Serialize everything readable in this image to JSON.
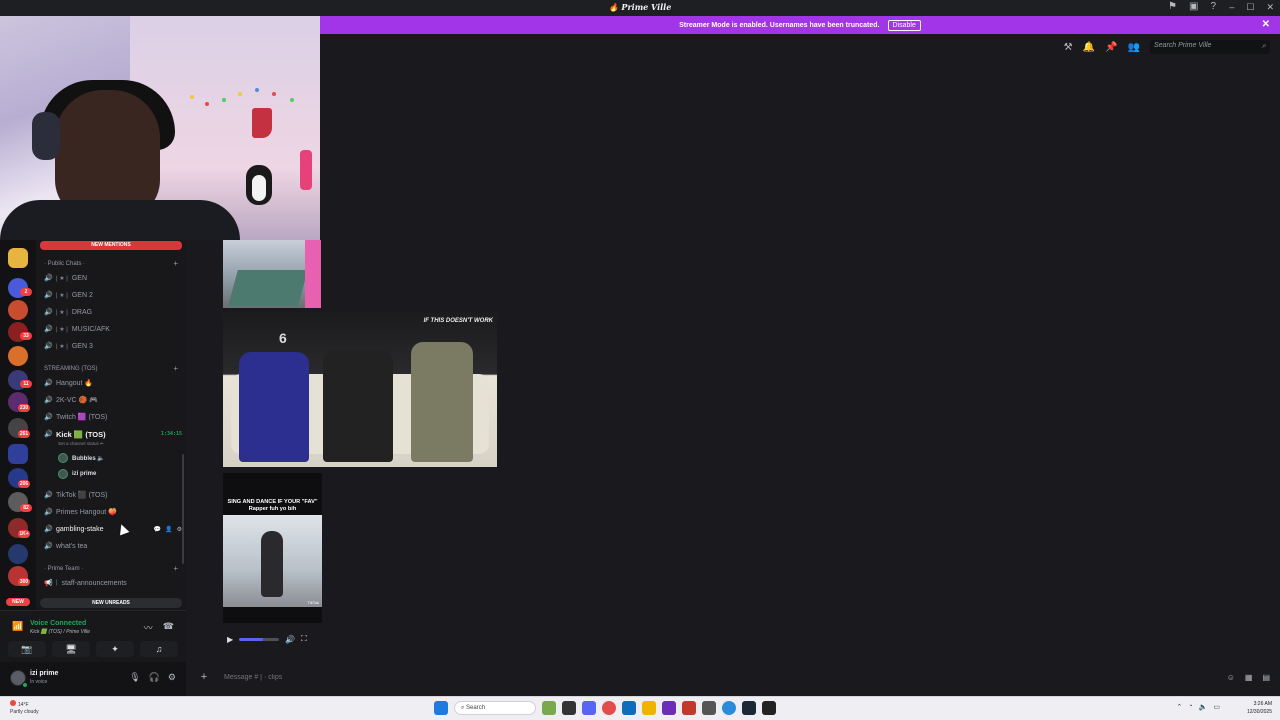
{
  "app": {
    "title": "Prime Ville",
    "title_icon": "discord-logo-icon",
    "window_controls": [
      "–",
      "☐",
      "✕"
    ]
  },
  "banner": {
    "text": "Streamer Mode is enabled. Usernames have been truncated.",
    "button": "Disable",
    "color": "#a335e8"
  },
  "header": {
    "search_placeholder": "Search Prime Ville"
  },
  "server_rail": {
    "badges": [
      "2",
      "33",
      "11",
      "230",
      "261",
      "206",
      "82",
      "1K+",
      "300"
    ],
    "new_label": "NEW"
  },
  "channels": {
    "new_mentions": "NEW MENTIONS",
    "new_unreads": "NEW UNREADS",
    "categories": [
      {
        "label": "· Public Chats ·"
      },
      {
        "label": "STREAMING (TOS)"
      },
      {
        "label": "· Prime Team ·"
      }
    ],
    "public": [
      {
        "label": "GEN"
      },
      {
        "label": "GEN 2"
      },
      {
        "label": "DRAG"
      },
      {
        "label": "MUSIC/AFK"
      },
      {
        "label": "GEN 3"
      }
    ],
    "streaming": [
      {
        "label": "Hangout 🔥"
      },
      {
        "label": "2K-VC 🏀 🎮"
      },
      {
        "label": "Twitch 🟪 (TOS)"
      }
    ],
    "active": {
      "label": "Kick 🟩 (TOS)",
      "timer": "1:34:15",
      "status": "Set a channel status ✏"
    },
    "voice_users": [
      {
        "name": "Bubbles 🔈"
      },
      {
        "name": "izi prime"
      }
    ],
    "more": [
      {
        "label": "TikTok ⬛ (TOS)"
      },
      {
        "label": "Primes Hangout 🍑"
      },
      {
        "label": "gambling-stake"
      },
      {
        "label": "what's tea"
      }
    ],
    "staff": {
      "label": "staff-announcements"
    }
  },
  "voice": {
    "status": "Voice Connected",
    "channel": "Kick 🟩 (TOS) / Prime Ville"
  },
  "user": {
    "name": "izi prime",
    "status": "In voice"
  },
  "media": {
    "clip2_watermark": "IF THIS DOESN'T WORK",
    "clip2_channel": "6",
    "clip3_caption": "SING AND DANCE IF YOUR \"FAV\" Rapper fuh yo bih",
    "clip3_source": "TikTok",
    "video_volume": 0.6
  },
  "composer": {
    "placeholder": "Message # | · clips"
  },
  "taskbar": {
    "weather_temp": "14°F",
    "weather_desc": "Partly cloudy",
    "search": "Search",
    "time": "3:26 AM",
    "date": "12/30/2025"
  }
}
